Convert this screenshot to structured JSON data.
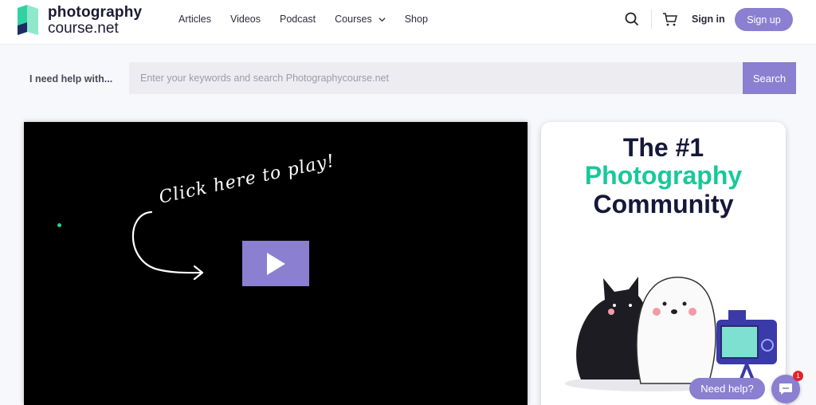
{
  "brand": {
    "line1": "photography",
    "line2": "course.net"
  },
  "nav": {
    "items": [
      {
        "label": "Articles"
      },
      {
        "label": "Videos"
      },
      {
        "label": "Podcast"
      },
      {
        "label": "Courses",
        "has_dropdown": true
      },
      {
        "label": "Shop"
      }
    ]
  },
  "header": {
    "search_icon": "search-icon",
    "cart_icon": "cart-icon",
    "signin_label": "Sign in",
    "signup_label": "Sign up"
  },
  "search": {
    "help_label": "I need help with...",
    "placeholder": "Enter your keywords and search Photographycourse.net",
    "value": "",
    "button_label": "Search"
  },
  "video": {
    "overlay_text": "Click here to play!",
    "play_icon": "play-icon"
  },
  "promo": {
    "line1": "The #1",
    "line2": "Photography",
    "line3": "Community"
  },
  "chat": {
    "bubble_label": "Need help?",
    "badge_count": "1",
    "icon": "chat-icon"
  },
  "colors": {
    "accent": "#8a7fd0",
    "brand_green": "#17c99a",
    "dark_navy": "#151838",
    "badge_red": "#e0242b"
  }
}
